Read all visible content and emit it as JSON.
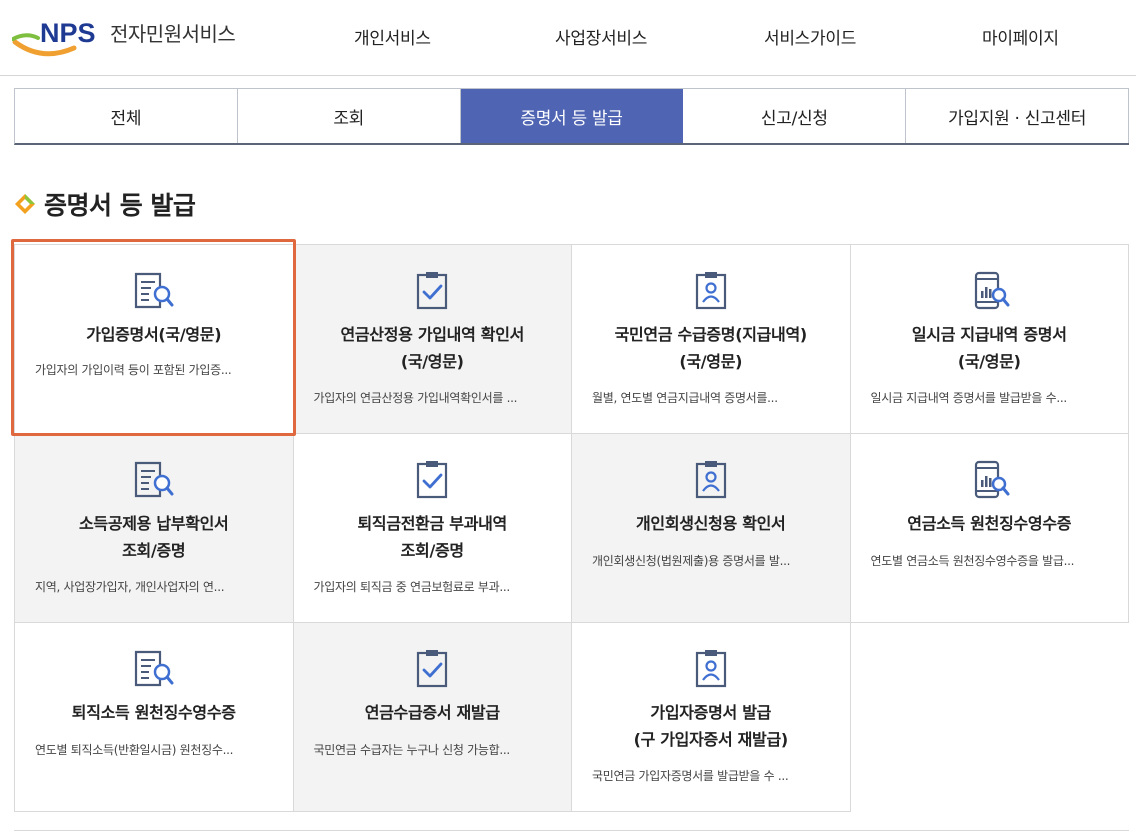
{
  "header": {
    "logo_mark": "NPS",
    "logo_text": "전자민원서비스",
    "nav": [
      "개인서비스",
      "사업장서비스",
      "서비스가이드",
      "마이페이지"
    ]
  },
  "tabs": [
    {
      "label": "전체",
      "active": false
    },
    {
      "label": "조회",
      "active": false
    },
    {
      "label": "증명서 등 발급",
      "active": true
    },
    {
      "label": "신고/신청",
      "active": false
    },
    {
      "label": "가입지원 · 신고센터",
      "active": false
    }
  ],
  "section": {
    "title": "증명서 등 발급",
    "bullet_icon": "diamond-bullet-icon"
  },
  "colors": {
    "accent": "#4f64b3",
    "focus": "#e0683f",
    "icon": "#4a5a7a",
    "icon_highlight": "#3f6fd1"
  },
  "cards": [
    {
      "title": [
        "가입증명서(국/영문)"
      ],
      "desc": "가입자의 가입이력 등이 포함된 가입증...",
      "icon": "document-search-icon"
    },
    {
      "title": [
        "연금산정용 가입내역 확인서",
        "(국/영문)"
      ],
      "desc": "가입자의 연금산정용 가입내역확인서를 ...",
      "icon": "clipboard-check-icon"
    },
    {
      "title": [
        "국민연금 수급증명(지급내역)",
        "(국/영문)"
      ],
      "desc": "월별, 연도별 연금지급내역 증명서를...",
      "icon": "id-badge-icon"
    },
    {
      "title": [
        "일시금 지급내역 증명서",
        "(국/영문)"
      ],
      "desc": "일시금 지급내역 증명서를 발급받을 수...",
      "icon": "mobile-chart-search-icon"
    },
    {
      "title": [
        "소득공제용 납부확인서",
        "조회/증명"
      ],
      "desc": "지역, 사업장가입자, 개인사업자의 연...",
      "icon": "document-search-icon"
    },
    {
      "title": [
        "퇴직금전환금 부과내역",
        "조회/증명"
      ],
      "desc": "가입자의 퇴직금 중 연금보험료로 부과...",
      "icon": "clipboard-check-icon"
    },
    {
      "title": [
        "개인회생신청용 확인서"
      ],
      "desc": "개인회생신청(법원제출)용 증명서를 발...",
      "icon": "id-badge-icon"
    },
    {
      "title": [
        "연금소득 원천징수영수증"
      ],
      "desc": "연도별 연금소득 원천징수영수증을 발급...",
      "icon": "mobile-chart-search-icon"
    },
    {
      "title": [
        "퇴직소득 원천징수영수증"
      ],
      "desc": "연도별 퇴직소득(반환일시금) 원천징수...",
      "icon": "document-search-icon"
    },
    {
      "title": [
        "연금수급증서 재발급"
      ],
      "desc": "국민연금 수급자는 누구나 신청 가능합...",
      "icon": "clipboard-check-icon"
    },
    {
      "title": [
        "가입자증명서 발급",
        "(구 가입자증서 재발급)"
      ],
      "desc": "국민연금 가입자증명서를 발급받을 수 ...",
      "icon": "id-badge-icon"
    }
  ]
}
